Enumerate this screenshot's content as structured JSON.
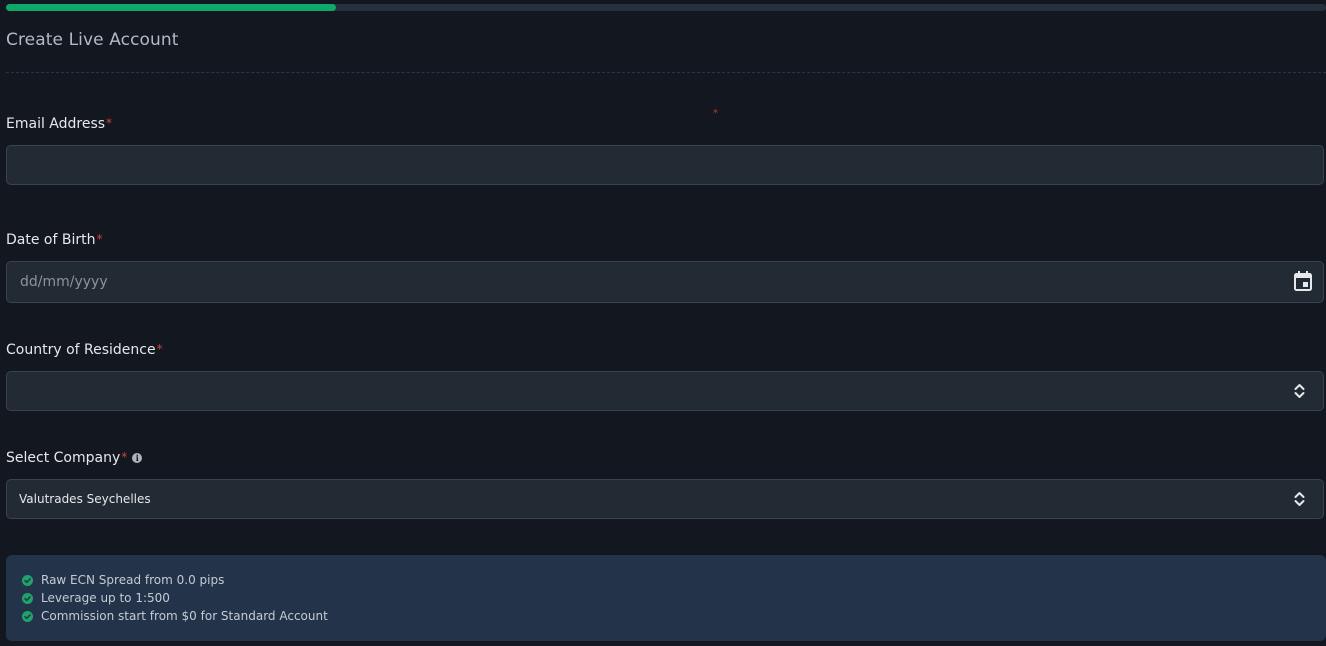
{
  "progress": {
    "value": 0.25
  },
  "page": {
    "title": "Create Live Account"
  },
  "stray_marker": "*",
  "form": {
    "email": {
      "label": "Email Address",
      "required_mark": "*",
      "value": ""
    },
    "dob": {
      "label": "Date of Birth",
      "required_mark": "*",
      "placeholder": "dd/mm/yyyy",
      "icon": "calendar-icon"
    },
    "country": {
      "label": "Country of Residence",
      "required_mark": "*",
      "value": "",
      "icon": "sort-arrows-icon"
    },
    "company": {
      "label": "Select Company",
      "required_mark": "*",
      "info_icon": "info-icon",
      "value": "Valutrades Seychelles",
      "icon": "sort-arrows-icon"
    }
  },
  "benefits": [
    {
      "text": "Raw ECN Spread from 0.0 pips",
      "icon": "check-circle-icon"
    },
    {
      "text": "Leverage up to 1:500",
      "icon": "check-circle-icon"
    },
    {
      "text": "Commission start from $0 for Standard Account",
      "icon": "check-circle-icon"
    }
  ],
  "colors": {
    "background": "#131720",
    "accent": "#0ea86a",
    "required": "#d0453a",
    "field_bg": "#222a34",
    "benefits_bg": "#23334a",
    "check": "#1fa36a"
  }
}
